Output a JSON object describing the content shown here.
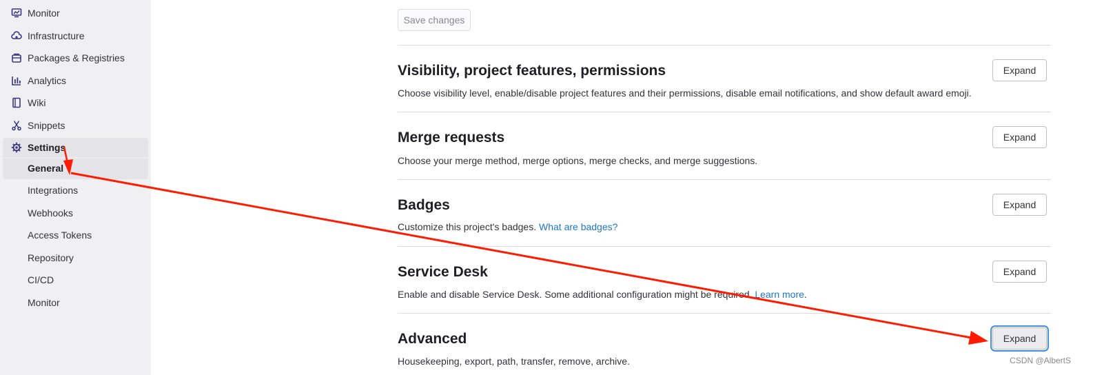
{
  "sidebar": {
    "items": [
      {
        "label": "Monitor",
        "icon": "monitor-icon"
      },
      {
        "label": "Infrastructure",
        "icon": "cloud-icon"
      },
      {
        "label": "Packages & Registries",
        "icon": "package-icon"
      },
      {
        "label": "Analytics",
        "icon": "chart-icon"
      },
      {
        "label": "Wiki",
        "icon": "book-icon"
      },
      {
        "label": "Snippets",
        "icon": "scissors-icon"
      },
      {
        "label": "Settings",
        "icon": "gear-icon"
      }
    ],
    "subitems": [
      {
        "label": "General",
        "active": true
      },
      {
        "label": "Integrations"
      },
      {
        "label": "Webhooks"
      },
      {
        "label": "Access Tokens"
      },
      {
        "label": "Repository"
      },
      {
        "label": "CI/CD"
      },
      {
        "label": "Monitor"
      }
    ]
  },
  "main": {
    "save_label": "Save changes",
    "sections": [
      {
        "title": "Visibility, project features, permissions",
        "description": "Choose visibility level, enable/disable project features and their permissions, disable email notifications, and show default award emoji.",
        "button": "Expand"
      },
      {
        "title": "Merge requests",
        "description": "Choose your merge method, merge options, merge checks, and merge suggestions.",
        "button": "Expand"
      },
      {
        "title": "Badges",
        "description": "Customize this project's badges.",
        "link": "What are badges?",
        "button": "Expand"
      },
      {
        "title": "Service Desk",
        "description": "Enable and disable Service Desk. Some additional configuration might be required.",
        "link": "Learn more",
        "suffix": ".",
        "button": "Expand"
      },
      {
        "title": "Advanced",
        "description": "Housekeeping, export, path, transfer, remove, archive.",
        "button": "Expand"
      }
    ]
  },
  "watermark": "CSDN @AlbertS",
  "colors": {
    "sidebar_bg": "#f0f0f2",
    "link": "#1f75cb",
    "arrow": "#ff1a00",
    "focus_ring": "#428fdc"
  }
}
